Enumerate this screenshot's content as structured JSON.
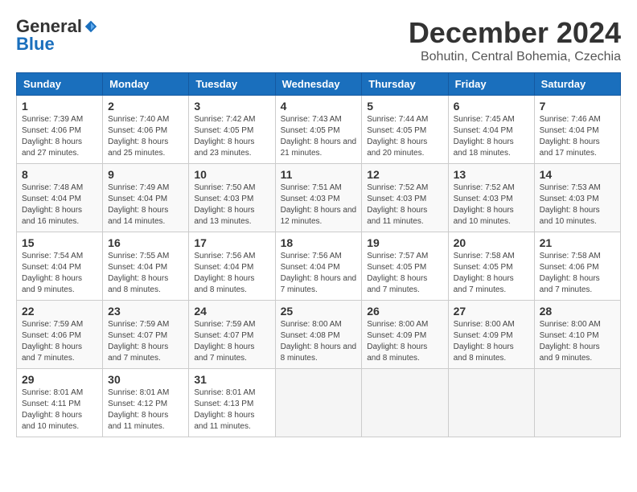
{
  "logo": {
    "general": "General",
    "blue": "Blue"
  },
  "header": {
    "title": "December 2024",
    "subtitle": "Bohutin, Central Bohemia, Czechia"
  },
  "days_of_week": [
    "Sunday",
    "Monday",
    "Tuesday",
    "Wednesday",
    "Thursday",
    "Friday",
    "Saturday"
  ],
  "weeks": [
    [
      {
        "day": "1",
        "sunrise": "7:39 AM",
        "sunset": "4:06 PM",
        "daylight": "8 hours and 27 minutes."
      },
      {
        "day": "2",
        "sunrise": "7:40 AM",
        "sunset": "4:06 PM",
        "daylight": "8 hours and 25 minutes."
      },
      {
        "day": "3",
        "sunrise": "7:42 AM",
        "sunset": "4:05 PM",
        "daylight": "8 hours and 23 minutes."
      },
      {
        "day": "4",
        "sunrise": "7:43 AM",
        "sunset": "4:05 PM",
        "daylight": "8 hours and 21 minutes."
      },
      {
        "day": "5",
        "sunrise": "7:44 AM",
        "sunset": "4:05 PM",
        "daylight": "8 hours and 20 minutes."
      },
      {
        "day": "6",
        "sunrise": "7:45 AM",
        "sunset": "4:04 PM",
        "daylight": "8 hours and 18 minutes."
      },
      {
        "day": "7",
        "sunrise": "7:46 AM",
        "sunset": "4:04 PM",
        "daylight": "8 hours and 17 minutes."
      }
    ],
    [
      {
        "day": "8",
        "sunrise": "7:48 AM",
        "sunset": "4:04 PM",
        "daylight": "8 hours and 16 minutes."
      },
      {
        "day": "9",
        "sunrise": "7:49 AM",
        "sunset": "4:04 PM",
        "daylight": "8 hours and 14 minutes."
      },
      {
        "day": "10",
        "sunrise": "7:50 AM",
        "sunset": "4:03 PM",
        "daylight": "8 hours and 13 minutes."
      },
      {
        "day": "11",
        "sunrise": "7:51 AM",
        "sunset": "4:03 PM",
        "daylight": "8 hours and 12 minutes."
      },
      {
        "day": "12",
        "sunrise": "7:52 AM",
        "sunset": "4:03 PM",
        "daylight": "8 hours and 11 minutes."
      },
      {
        "day": "13",
        "sunrise": "7:52 AM",
        "sunset": "4:03 PM",
        "daylight": "8 hours and 10 minutes."
      },
      {
        "day": "14",
        "sunrise": "7:53 AM",
        "sunset": "4:03 PM",
        "daylight": "8 hours and 10 minutes."
      }
    ],
    [
      {
        "day": "15",
        "sunrise": "7:54 AM",
        "sunset": "4:04 PM",
        "daylight": "8 hours and 9 minutes."
      },
      {
        "day": "16",
        "sunrise": "7:55 AM",
        "sunset": "4:04 PM",
        "daylight": "8 hours and 8 minutes."
      },
      {
        "day": "17",
        "sunrise": "7:56 AM",
        "sunset": "4:04 PM",
        "daylight": "8 hours and 8 minutes."
      },
      {
        "day": "18",
        "sunrise": "7:56 AM",
        "sunset": "4:04 PM",
        "daylight": "8 hours and 7 minutes."
      },
      {
        "day": "19",
        "sunrise": "7:57 AM",
        "sunset": "4:05 PM",
        "daylight": "8 hours and 7 minutes."
      },
      {
        "day": "20",
        "sunrise": "7:58 AM",
        "sunset": "4:05 PM",
        "daylight": "8 hours and 7 minutes."
      },
      {
        "day": "21",
        "sunrise": "7:58 AM",
        "sunset": "4:06 PM",
        "daylight": "8 hours and 7 minutes."
      }
    ],
    [
      {
        "day": "22",
        "sunrise": "7:59 AM",
        "sunset": "4:06 PM",
        "daylight": "8 hours and 7 minutes."
      },
      {
        "day": "23",
        "sunrise": "7:59 AM",
        "sunset": "4:07 PM",
        "daylight": "8 hours and 7 minutes."
      },
      {
        "day": "24",
        "sunrise": "7:59 AM",
        "sunset": "4:07 PM",
        "daylight": "8 hours and 7 minutes."
      },
      {
        "day": "25",
        "sunrise": "8:00 AM",
        "sunset": "4:08 PM",
        "daylight": "8 hours and 8 minutes."
      },
      {
        "day": "26",
        "sunrise": "8:00 AM",
        "sunset": "4:09 PM",
        "daylight": "8 hours and 8 minutes."
      },
      {
        "day": "27",
        "sunrise": "8:00 AM",
        "sunset": "4:09 PM",
        "daylight": "8 hours and 8 minutes."
      },
      {
        "day": "28",
        "sunrise": "8:00 AM",
        "sunset": "4:10 PM",
        "daylight": "8 hours and 9 minutes."
      }
    ],
    [
      {
        "day": "29",
        "sunrise": "8:01 AM",
        "sunset": "4:11 PM",
        "daylight": "8 hours and 10 minutes."
      },
      {
        "day": "30",
        "sunrise": "8:01 AM",
        "sunset": "4:12 PM",
        "daylight": "8 hours and 11 minutes."
      },
      {
        "day": "31",
        "sunrise": "8:01 AM",
        "sunset": "4:13 PM",
        "daylight": "8 hours and 11 minutes."
      },
      null,
      null,
      null,
      null
    ]
  ],
  "labels": {
    "sunrise": "Sunrise:",
    "sunset": "Sunset:",
    "daylight": "Daylight:"
  }
}
